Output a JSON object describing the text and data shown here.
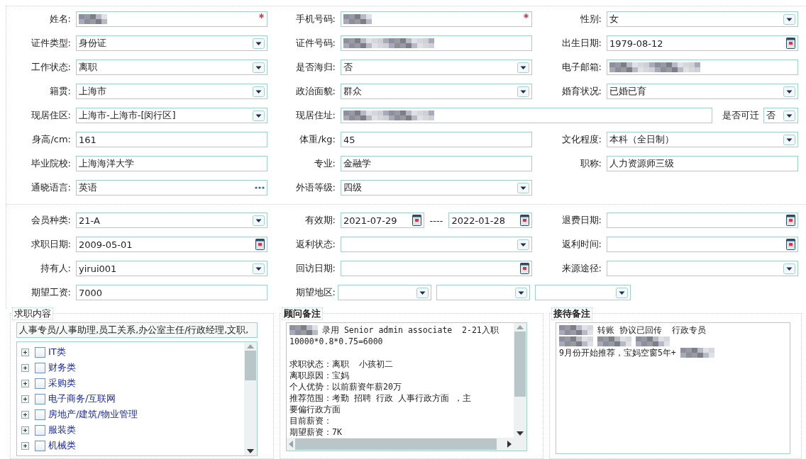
{
  "sections": [
    {
      "rows": [
        {
          "cells": [
            {
              "label": "姓名:",
              "field": {
                "kind": "text",
                "redacted": true,
                "required": true
              }
            },
            {
              "label": "手机号码:",
              "field": {
                "kind": "text",
                "redacted": true,
                "required": true
              }
            },
            {
              "label": "性别:",
              "field": {
                "kind": "select",
                "value": "女"
              }
            }
          ]
        },
        {
          "cells": [
            {
              "label": "证件类型:",
              "field": {
                "kind": "select",
                "value": "身份证"
              }
            },
            {
              "label": "证件号码:",
              "field": {
                "kind": "text",
                "redacted": true
              }
            },
            {
              "label": "出生日期:",
              "field": {
                "kind": "date",
                "value": "1979-08-12"
              }
            }
          ]
        },
        {
          "cells": [
            {
              "label": "工作状态:",
              "field": {
                "kind": "select",
                "value": "离职"
              }
            },
            {
              "label": "是否海归:",
              "field": {
                "kind": "select",
                "value": "否"
              }
            },
            {
              "label": "电子邮箱:",
              "field": {
                "kind": "text",
                "redacted": true
              }
            }
          ]
        },
        {
          "cells": [
            {
              "label": "籍贯:",
              "field": {
                "kind": "select",
                "value": "上海市"
              }
            },
            {
              "label": "政治面貌:",
              "field": {
                "kind": "select",
                "value": "群众"
              }
            },
            {
              "label": "婚育状况:",
              "field": {
                "kind": "select",
                "value": "已婚已育"
              }
            }
          ]
        },
        {
          "cells": [
            {
              "label": "现居住区:",
              "field": {
                "kind": "select",
                "value": " 上海市-上海市-[闵行区]"
              }
            },
            {
              "label": "现居住址:",
              "field": {
                "kind": "text",
                "redacted": true
              },
              "extra": {
                "label": "是否可迁",
                "field": {
                  "kind": "select",
                  "value": "否"
                }
              }
            }
          ]
        },
        {
          "cells": [
            {
              "label": "身高/cm:",
              "field": {
                "kind": "text",
                "value": "161"
              }
            },
            {
              "label": "体重/kg:",
              "field": {
                "kind": "text",
                "value": "45"
              }
            },
            {
              "label": "文化程度:",
              "field": {
                "kind": "select",
                "value": "本科（全日制）"
              }
            }
          ]
        },
        {
          "cells": [
            {
              "label": "毕业院校:",
              "field": {
                "kind": "text",
                "value": "上海海洋大学"
              }
            },
            {
              "label": "专业:",
              "field": {
                "kind": "text",
                "value": "金融学"
              }
            },
            {
              "label": "职称:",
              "field": {
                "kind": "text",
                "value": "人力资源师三级"
              }
            }
          ]
        },
        {
          "cells": [
            {
              "label": "通晓语言:",
              "field": {
                "kind": "picker",
                "value": "英语"
              }
            },
            {
              "label": "外语等级:",
              "field": {
                "kind": "select",
                "value": "四级"
              }
            }
          ]
        }
      ]
    },
    {
      "rows": [
        {
          "cells": [
            {
              "label": "会员种类:",
              "field": {
                "kind": "select",
                "value": " 21-A"
              }
            },
            {
              "label": "有效期:",
              "field": {
                "kind": "range",
                "from": "2021-07-29",
                "separator": "----",
                "to": "2022-01-28"
              }
            },
            {
              "label": "退费日期:",
              "field": {
                "kind": "date"
              }
            }
          ]
        },
        {
          "cells": [
            {
              "label": "求职日期:",
              "field": {
                "kind": "date",
                "value": "2009-05-01"
              }
            },
            {
              "label": "返利状态:",
              "field": {
                "kind": "select"
              }
            },
            {
              "label": "返利时间:",
              "field": {
                "kind": "date"
              }
            }
          ]
        },
        {
          "cells": [
            {
              "label": "持有人:",
              "field": {
                "kind": "select",
                "value": "yirui001"
              }
            },
            {
              "label": "回访日期:",
              "field": {
                "kind": "date"
              }
            },
            {
              "label": "来源途径:",
              "field": {
                "kind": "select"
              }
            }
          ]
        },
        {
          "cells": [
            {
              "label": "期望工资:",
              "field": {
                "kind": "text",
                "value": "7000"
              }
            },
            {
              "label": "期望地区:",
              "field": {
                "kind": "multi",
                "parts": [
                  {
                    "kind": "select"
                  },
                  {
                    "kind": "select"
                  },
                  {
                    "kind": "select"
                  }
                ]
              }
            }
          ]
        }
      ]
    }
  ],
  "job_interest": {
    "title": "求职内容",
    "tags": "人事专员/人事助理,员工关系,办公室主任/行政经理,文职,",
    "tree": [
      {
        "label": "IT类",
        "checked": false,
        "expanded": false
      },
      {
        "label": "财务类",
        "checked": false,
        "expanded": false
      },
      {
        "label": "采购类",
        "checked": false,
        "expanded": false
      },
      {
        "label": "电子商务/互联网",
        "checked": false,
        "expanded": false
      },
      {
        "label": "房地产/建筑/物业管理",
        "checked": false,
        "expanded": false
      },
      {
        "label": "服装类",
        "checked": false,
        "expanded": false
      },
      {
        "label": "机械类",
        "checked": false,
        "expanded": false
      }
    ]
  },
  "consultant_notes": {
    "title": "顾问备注",
    "lines": [
      {
        "segments": [
          {
            "kind": "redacted"
          },
          {
            "kind": "text",
            "text": "录用 Senior admin associate  2-21入职"
          }
        ]
      },
      {
        "segments": [
          {
            "kind": "text",
            "text": "10000*0.8*0.75=6000"
          }
        ]
      },
      {
        "segments": [
          {
            "kind": "blank"
          }
        ]
      },
      {
        "segments": [
          {
            "kind": "text",
            "text": "求职状态：离职  小孩初二"
          }
        ]
      },
      {
        "segments": [
          {
            "kind": "text",
            "text": "离职原因：宝妈"
          }
        ]
      },
      {
        "segments": [
          {
            "kind": "text",
            "text": "个人优势：以前薪资年薪20万"
          }
        ]
      },
      {
        "segments": [
          {
            "kind": "text",
            "text": "推荐范围：考勤 招聘 行政 人事行政方面 ，主"
          }
        ]
      },
      {
        "segments": [
          {
            "kind": "text",
            "text": "要偏行政方面"
          }
        ]
      },
      {
        "segments": [
          {
            "kind": "text",
            "text": "目前薪资："
          }
        ]
      },
      {
        "segments": [
          {
            "kind": "text",
            "text": "期望薪资：7K"
          }
        ]
      }
    ]
  },
  "reception_notes": {
    "title": "接待备注",
    "lines": [
      {
        "segments": [
          {
            "kind": "redacted"
          },
          {
            "kind": "text",
            "text": "转账 协议已回传  行政专员"
          }
        ]
      },
      {
        "segments": [
          {
            "kind": "redacted"
          },
          {
            "kind": "redacted"
          },
          {
            "kind": "redacted"
          }
        ]
      },
      {
        "segments": [
          {
            "kind": "text",
            "text": "9月份开始推荐，宝妈空窗5年+"
          },
          {
            "kind": "redacted"
          }
        ]
      }
    ]
  }
}
